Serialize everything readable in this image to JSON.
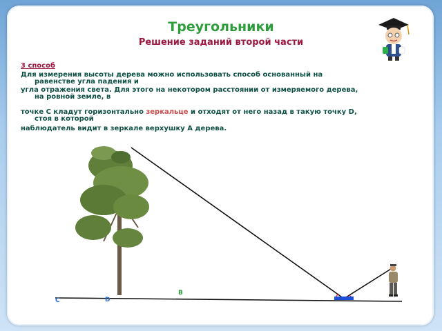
{
  "header": {
    "title": "Треугольники",
    "subtitle": "Решение заданий второй части"
  },
  "body": {
    "method": "3 способ",
    "line1": "Для измерения высоты дерева можно использовать способ основанный  на",
    "line1b": "равенстве угла падения и",
    "line2": "угла отражения света. Для этого на некотором расстоянии от  измеряемого дерева,",
    "line2b": "на ровной земле, в",
    "line3a": "точке С кладут горизонтально ",
    "line3_mirror": "зеркальце",
    "line3c": " и отходят от  него назад в такую точку D,",
    "line3b": "стоя в которой",
    "line4": "наблюдатель видит в зеркале верхушку А дерева."
  },
  "diagram": {
    "labels": {
      "point_b": "B",
      "point_c": "C",
      "point_d": "D"
    },
    "colors": {
      "label_b": "#2e9e3c",
      "label_cd": "#2a6fd1",
      "mirror": "#1d4fd8",
      "line": "#111111"
    }
  },
  "icons": {
    "mascot": "graduate-cap-character",
    "tree": "pine-tree",
    "person": "standing-observer"
  }
}
